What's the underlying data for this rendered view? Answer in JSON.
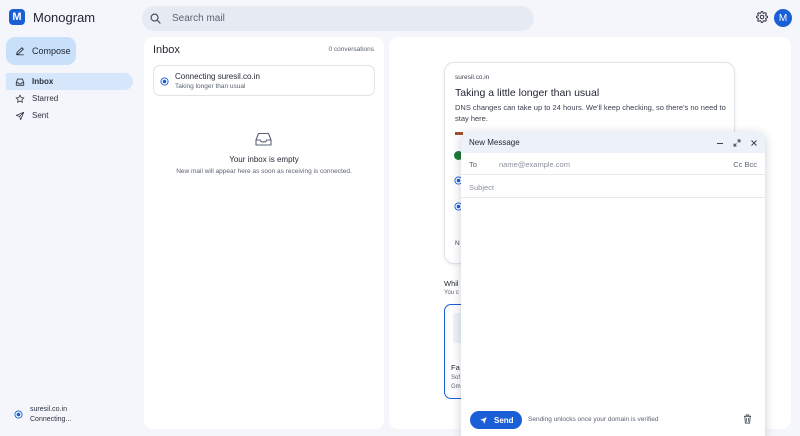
{
  "app": {
    "name": "Monogram",
    "logo_letter": "M",
    "accent": "#1a5fd6"
  },
  "search": {
    "placeholder": "Search mail"
  },
  "header": {
    "avatar_letter": "M"
  },
  "sidebar": {
    "compose_label": "Compose",
    "items": [
      {
        "label": "Inbox",
        "icon": "inbox-icon",
        "active": true
      },
      {
        "label": "Starred",
        "icon": "star-icon",
        "active": false
      },
      {
        "label": "Sent",
        "icon": "send-icon",
        "active": false
      }
    ],
    "account": {
      "domain": "suresil.co.in",
      "status": "Connecting..."
    }
  },
  "inbox": {
    "title": "Inbox",
    "count": "0 conversations",
    "connecting": {
      "title": "Connecting suresil.co.in",
      "subtitle": "Taking longer than usual"
    },
    "empty": {
      "title": "Your inbox is empty",
      "subtitle": "New mail will appear here as soon as receiving is connected."
    }
  },
  "status_card": {
    "domain": "suresil.co.in",
    "title": "Taking a little longer than usual",
    "description": "DNS changes can take up to 24 hours. We'll keep checking, so there's no need to stay here.",
    "letter_fragment": "N",
    "while_fragment": "Whil",
    "you_fragment": "You c",
    "card_title_fragment": "Fa",
    "card_sub1_fragment": "Sof",
    "card_sub2_fragment": "Gm"
  },
  "compose": {
    "title": "New Message",
    "to_label": "To",
    "to_placeholder": "name@example.com",
    "cc_bcc": "Cc Bcc",
    "subject_placeholder": "Subject",
    "send_label": "Send",
    "send_note": "Sending unlocks once your domain is verified"
  }
}
